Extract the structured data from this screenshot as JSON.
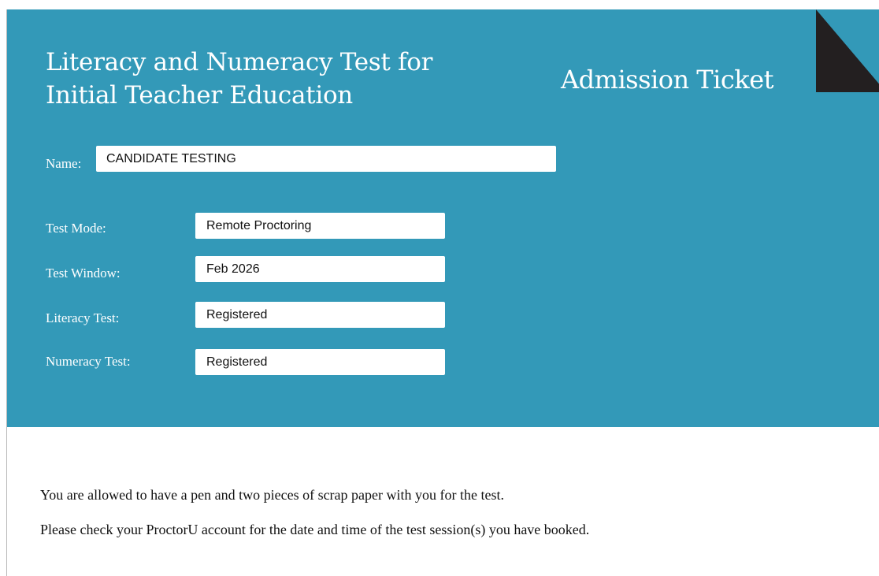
{
  "header": {
    "title_line1": "Literacy and Numeracy Test for",
    "title_line2": "Initial Teacher Education",
    "ticket_label": "Admission Ticket"
  },
  "fields": {
    "name_label": "Name:",
    "name_value": "CANDIDATE TESTING",
    "test_mode_label": "Test Mode:",
    "test_mode_value": "Remote Proctoring",
    "test_window_label": "Test Window:",
    "test_window_value": "Feb 2026",
    "literacy_label": "Literacy Test:",
    "literacy_value": "Registered",
    "numeracy_label": "Numeracy Test:",
    "numeracy_value": "Registered"
  },
  "notes": {
    "line1": "You are allowed to have a pen and two pieces of scrap paper with you for the test.",
    "line2": "Please check your ProctorU account for the date and time of the test session(s) you have booked."
  },
  "colors": {
    "header_background": "#3399b8",
    "corner_triangle": "#231f20"
  }
}
